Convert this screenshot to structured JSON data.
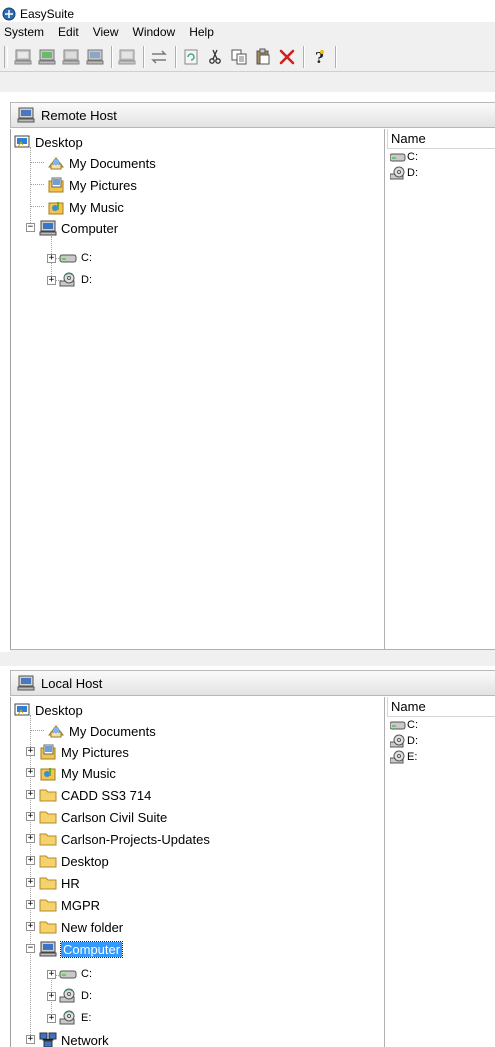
{
  "window": {
    "title": "EasySuite"
  },
  "menu": [
    "System",
    "Edit",
    "View",
    "Window",
    "Help"
  ],
  "toolbar": {
    "buttons": [
      "connect-host-icon",
      "remote-host-icon",
      "host-icon",
      "host-settings-icon",
      "disconnect-icon",
      "transfer-icon",
      "refresh-icon",
      "cut-icon",
      "copy-icon",
      "paste-icon",
      "delete-icon",
      "help-icon"
    ]
  },
  "remote": {
    "header": "Remote Host",
    "list_column": "Name",
    "tree": {
      "desktop": "Desktop",
      "my_documents": "My Documents",
      "my_pictures": "My Pictures",
      "my_music": "My Music",
      "computer": "Computer",
      "drive_c": "C:",
      "drive_d": "D:"
    },
    "list_items": [
      "C:",
      "D:"
    ]
  },
  "local": {
    "header": "Local Host",
    "list_column": "Name",
    "tree": {
      "desktop": "Desktop",
      "my_documents": "My Documents",
      "my_pictures": "My Pictures",
      "my_music": "My Music",
      "folders": [
        "CADD SS3 714",
        "Carlson Civil Suite",
        "Carlson-Projects-Updates",
        "Desktop",
        "HR",
        "MGPR",
        "New folder"
      ],
      "computer": "Computer",
      "drive_c": "C:",
      "drive_d": "D:",
      "drive_e": "E:",
      "network": "Network"
    },
    "list_items": [
      "C:",
      "D:",
      "E:"
    ]
  }
}
